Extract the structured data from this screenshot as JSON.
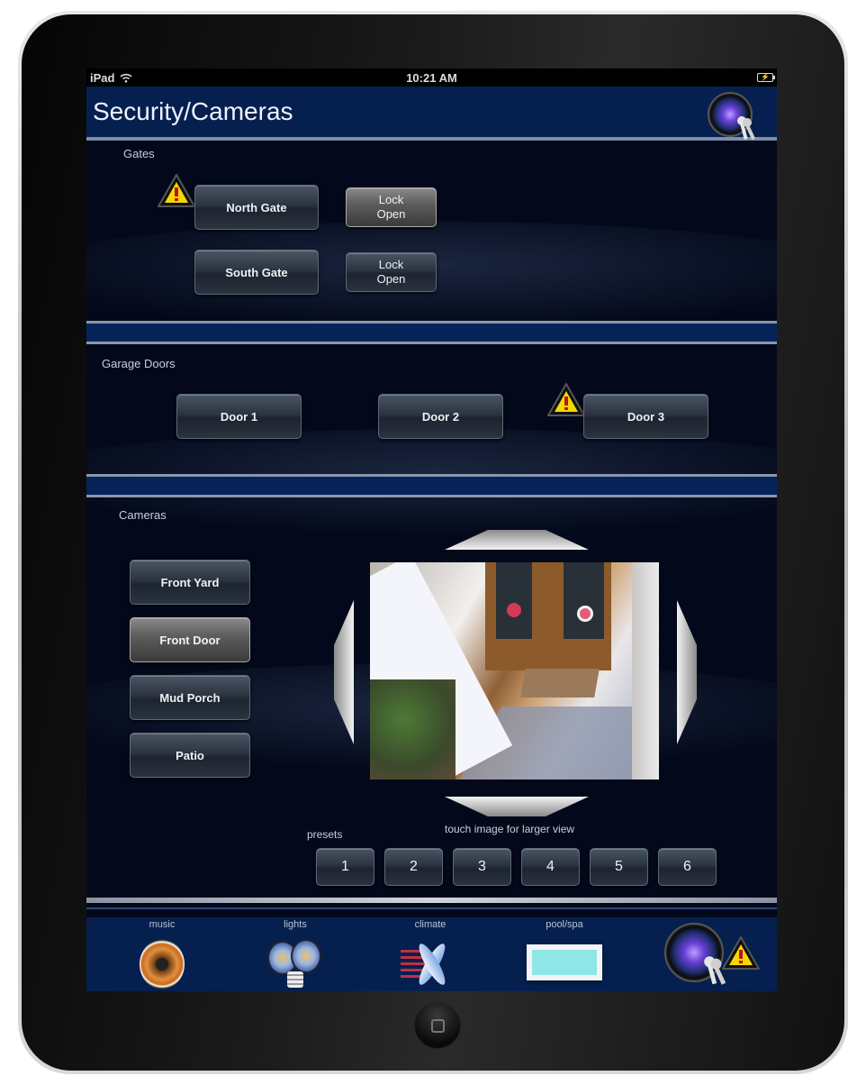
{
  "statusbar": {
    "device": "iPad",
    "time": "10:21 AM",
    "wifi_icon": "wifi-icon",
    "battery_icon": "battery-charging-icon"
  },
  "header": {
    "title": "Security/Cameras",
    "icon": "camera-keys-icon"
  },
  "gates": {
    "label": "Gates",
    "items": [
      {
        "name": "North Gate",
        "alert": true,
        "lock_label_line1": "Lock",
        "lock_label_line2": "Open",
        "lock_active": true
      },
      {
        "name": "South Gate",
        "alert": false,
        "lock_label_line1": "Lock",
        "lock_label_line2": "Open",
        "lock_active": false
      }
    ]
  },
  "garage": {
    "label": "Garage Doors",
    "doors": [
      {
        "name": "Door 1",
        "alert": false
      },
      {
        "name": "Door 2",
        "alert": false
      },
      {
        "name": "Door 3",
        "alert": true
      }
    ]
  },
  "cameras": {
    "label": "Cameras",
    "list": [
      {
        "name": "Front Yard",
        "selected": false
      },
      {
        "name": "Front Door",
        "selected": true
      },
      {
        "name": "Mud Porch",
        "selected": false
      },
      {
        "name": "Patio",
        "selected": false
      }
    ],
    "hint": "touch image for larger view",
    "presets_label": "presets",
    "presets": [
      "1",
      "2",
      "3",
      "4",
      "5",
      "6"
    ],
    "pan_controls": [
      "pan-up-icon",
      "pan-down-icon",
      "pan-left-icon",
      "pan-right-icon"
    ]
  },
  "dock": {
    "items": [
      {
        "label": "music",
        "icon": "speaker-icon"
      },
      {
        "label": "lights",
        "icon": "light-bulbs-icon"
      },
      {
        "label": "climate",
        "icon": "fan-icon"
      },
      {
        "label": "pool/spa",
        "icon": "pool-icon"
      },
      {
        "label": "",
        "icon": "camera-keys-icon",
        "alert": true
      }
    ]
  },
  "colors": {
    "header_blue": "#05204f",
    "background": "#03091a",
    "alert_yellow": "#f5d800"
  }
}
